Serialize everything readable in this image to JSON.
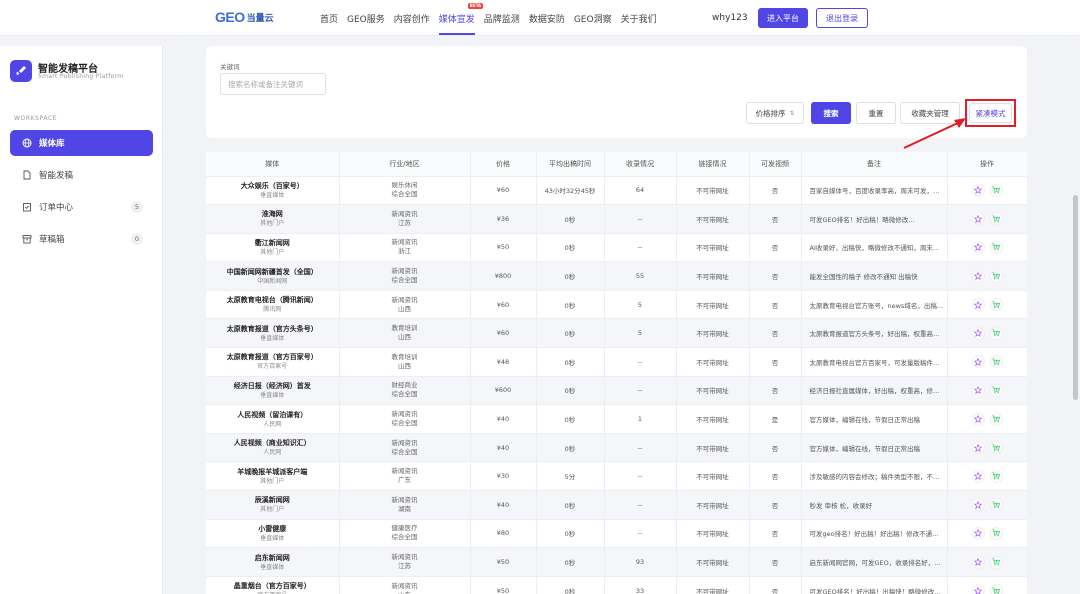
{
  "nav": {
    "logo_text": "GEO",
    "logo_cn": "当量云",
    "links": [
      "首页",
      "GEO服务",
      "内容创作",
      "媒体宣发",
      "品牌监测",
      "数据安防",
      "GEO洞察",
      "关于我们"
    ],
    "active_index": 3,
    "beta_badge": "BETA",
    "username": "why123",
    "enter_label": "进入平台",
    "logout_label": "退出登录"
  },
  "sidebar": {
    "title": "智能发稿平台",
    "subtitle": "Smart Publishing Platform",
    "section": "WORKSPACE",
    "items": [
      {
        "label": "媒体库",
        "icon": "globe-icon",
        "active": true
      },
      {
        "label": "智能发稿",
        "icon": "document-icon"
      },
      {
        "label": "订单中心",
        "icon": "clipboard-icon",
        "count": "5"
      },
      {
        "label": "草稿箱",
        "icon": "archive-icon",
        "count": "0"
      }
    ]
  },
  "filter": {
    "keyword_label": "关键词",
    "keyword_placeholder": "搜索名称或备注关键词",
    "sort_label": "价格排序",
    "search_label": "搜索",
    "reset_label": "重置",
    "favorites_label": "收藏夹管理",
    "compact_label": "紧凑模式"
  },
  "table": {
    "headers": [
      "媒体",
      "行业/地区",
      "价格",
      "平均出稿时间",
      "收录情况",
      "链接情况",
      "可发视频",
      "备注",
      "操作"
    ],
    "rows": [
      {
        "name": "大众娱乐（百家号）",
        "sub": "垂直媒体",
        "ind": "娱乐休闲",
        "region": "综合全国",
        "price": "¥60",
        "time": "43小时32分45秒",
        "incl": "64",
        "link": "不可带网址",
        "video": "否",
        "note": "百家自媒体号，百度收录率高，周末可发，不..."
      },
      {
        "name": "淮海网",
        "sub": "其他门户",
        "ind": "新闻资讯",
        "region": "江苏",
        "price": "¥36",
        "time": "0秒",
        "incl": "--",
        "link": "不可带网址",
        "video": "否",
        "note": "可发GEO排名！好出稿！略微修改..."
      },
      {
        "name": "衢江新闻网",
        "sub": "其他门户",
        "ind": "新闻资讯",
        "region": "浙江",
        "price": "¥50",
        "time": "0秒",
        "incl": "--",
        "link": "不可带网址",
        "video": "否",
        "note": "AI收录好，出稿快，略微修改不通知，周末可..."
      },
      {
        "name": "中国新闻网新疆首发（全国）",
        "sub": "中国新闻网",
        "ind": "新闻资讯",
        "region": "综合全国",
        "price": "¥800",
        "time": "0秒",
        "incl": "55",
        "link": "不可带网址",
        "video": "否",
        "note": "能发全国性的稿子 修改不通知 出稿快"
      },
      {
        "name": "太原教育电视台（腾讯新闻）",
        "sub": "腾讯网",
        "ind": "新闻资讯",
        "region": "山西",
        "price": "¥60",
        "time": "0秒",
        "incl": "5",
        "link": "不可带网址",
        "video": "否",
        "note": "太原教育电视台官方账号，news域名，出稿..."
      },
      {
        "name": "太原教育报道（官方头条号）",
        "sub": "垂直媒体",
        "ind": "教育培训",
        "region": "山西",
        "price": "¥60",
        "time": "0秒",
        "incl": "5",
        "link": "不可带网址",
        "video": "否",
        "note": "太原教育报道官方头条号，好出稿，权重高，..."
      },
      {
        "name": "太原教育报道（官方百家号）",
        "sub": "官方百家号",
        "ind": "教育培训",
        "region": "山西",
        "price": "¥48",
        "time": "0秒",
        "incl": "--",
        "link": "不可带网址",
        "video": "否",
        "note": "太原教育电视台官方百家号，可发量版稿件，..."
      },
      {
        "name": "经济日报（经济网）首发",
        "sub": "垂直媒体",
        "ind": "财经商业",
        "region": "综合全国",
        "price": "¥600",
        "time": "0秒",
        "incl": "--",
        "link": "不可带网址",
        "video": "否",
        "note": "经济日报社直属媒体，好出稿，权重高，修改..."
      },
      {
        "name": "人民视频（留泊课有）",
        "sub": "人民网",
        "ind": "新闻资讯",
        "region": "综合全国",
        "price": "¥40",
        "time": "0秒",
        "incl": "1",
        "link": "不可带网址",
        "video": "是",
        "note": "官方媒体，编辑在线，节假日正常出稿"
      },
      {
        "name": "人民视频（商业知识汇）",
        "sub": "人民网",
        "ind": "新闻资讯",
        "region": "综合全国",
        "price": "¥40",
        "time": "0秒",
        "incl": "--",
        "link": "不可带网址",
        "video": "否",
        "note": "官方媒体，编辑在线，节假日正常出稿"
      },
      {
        "name": "羊城晚报羊城派客户端",
        "sub": "其他门户",
        "ind": "新闻资讯",
        "region": "广东",
        "price": "¥30",
        "time": "5分",
        "incl": "--",
        "link": "不可带网址",
        "video": "否",
        "note": "涉及敏感的内容会修改；稿件类型不限，不包..."
      },
      {
        "name": "辰溪新闻网",
        "sub": "其他门户",
        "ind": "新闻资讯",
        "region": "湖南",
        "price": "¥40",
        "time": "0秒",
        "incl": "--",
        "link": "不可带网址",
        "video": "否",
        "note": "秒发 审核 松，收录好"
      },
      {
        "name": "小雷健康",
        "sub": "垂直媒体",
        "ind": "健康医疗",
        "region": "综合全国",
        "price": "¥80",
        "time": "0秒",
        "incl": "--",
        "link": "不可带网址",
        "video": "否",
        "note": "可发geo排名！好出稿！好出稿！修改不通知！"
      },
      {
        "name": "启东新闻网",
        "sub": "垂直媒体",
        "ind": "新闻资讯",
        "region": "江苏",
        "price": "¥50",
        "time": "0秒",
        "incl": "93",
        "link": "不可带网址",
        "video": "否",
        "note": "启东新闻网官网，可发GEO，收录排名好，..."
      },
      {
        "name": "晶重烟台（官方百家号）",
        "sub": "官方百家号",
        "ind": "新闻资讯",
        "region": "山东",
        "price": "¥50",
        "time": "0秒",
        "incl": "33",
        "link": "不可带网址",
        "video": "否",
        "note": "可发GEO排名！好出稿！出稿快！略微修改..."
      }
    ]
  },
  "colors": {
    "accent": "#4f46e5",
    "highlight": "#e11d2a",
    "favorite": "#a855f7",
    "cart": "#22c55e"
  }
}
